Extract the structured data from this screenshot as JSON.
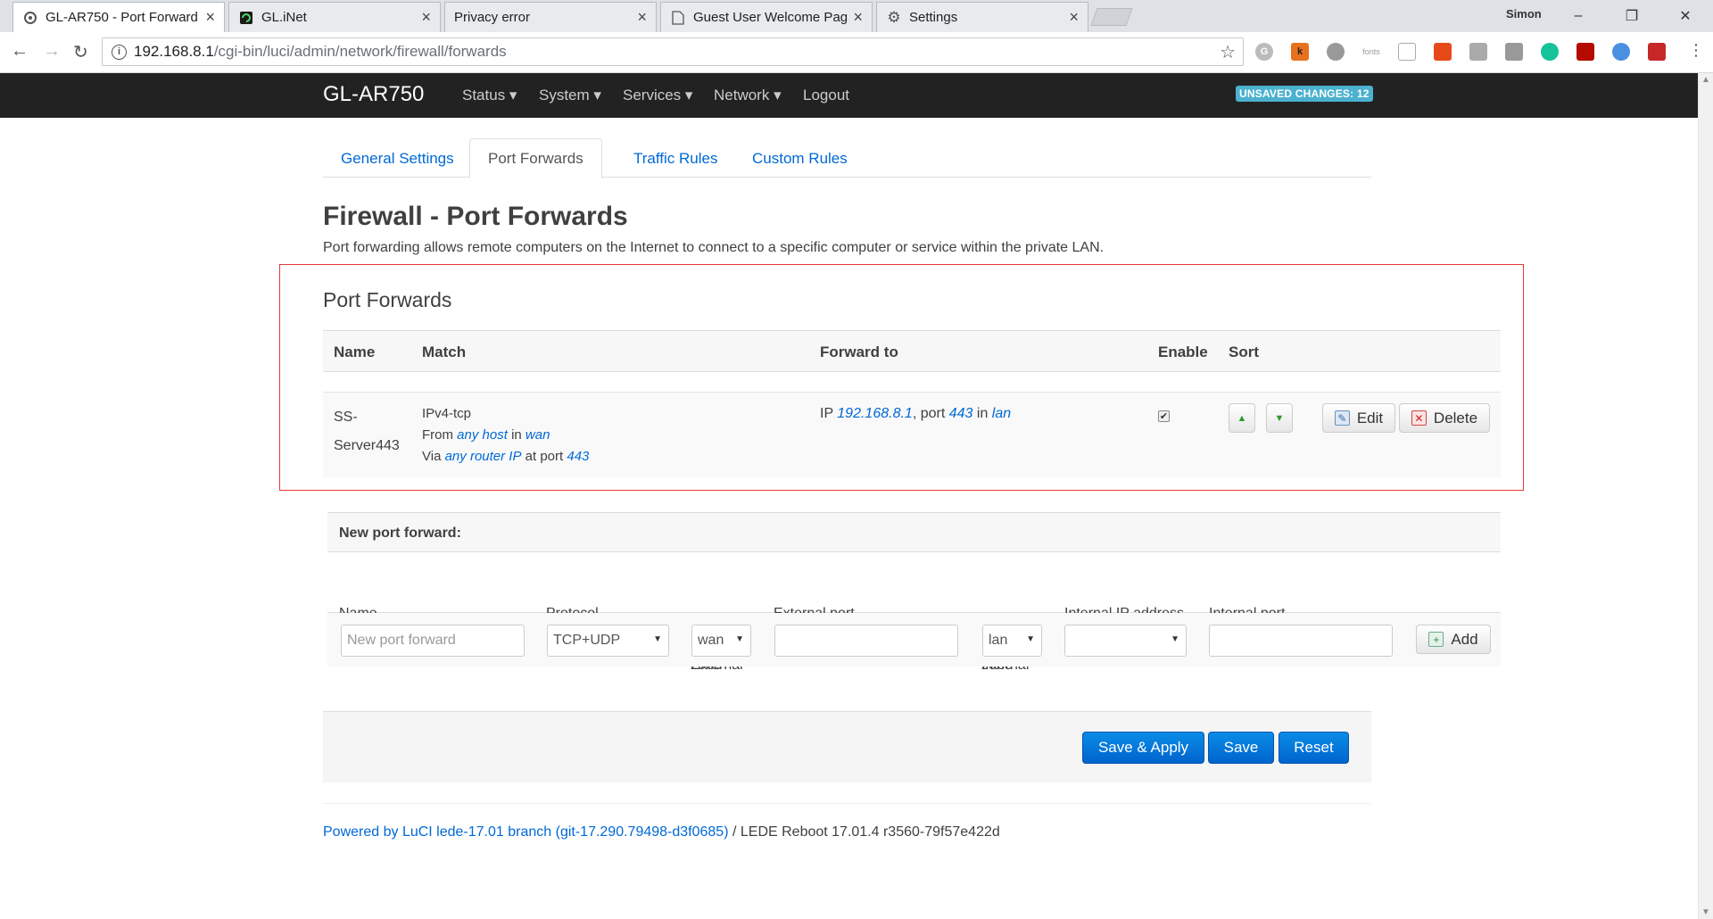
{
  "browser": {
    "tabs": [
      {
        "title": "GL-AR750 - Port Forward"
      },
      {
        "title": "GL.iNet"
      },
      {
        "title": "Privacy error"
      },
      {
        "title": "Guest User Welcome Pag"
      },
      {
        "title": "Settings"
      }
    ],
    "user": "Simon",
    "url_host": "192.168.8.1",
    "url_path": "/cgi-bin/luci/admin/network/firewall/forwards",
    "extensions": [
      "G",
      "k",
      "fonts"
    ]
  },
  "header": {
    "brand": "GL-AR750",
    "menu": [
      "Status",
      "System",
      "Services",
      "Network",
      "Logout"
    ],
    "unsaved": "UNSAVED CHANGES: 12"
  },
  "tabs": [
    "General Settings",
    "Port Forwards",
    "Traffic Rules",
    "Custom Rules"
  ],
  "page": {
    "title": "Firewall - Port Forwards",
    "description": "Port forwarding allows remote computers on the Internet to connect to a specific computer or service within the private LAN.",
    "section_title": "Port Forwards"
  },
  "table": {
    "headers": {
      "name": "Name",
      "match": "Match",
      "forward": "Forward to",
      "enable": "Enable",
      "sort": "Sort"
    },
    "row": {
      "name_line1": "SS-",
      "name_line2": "Server443",
      "proto": "IPv4-tcp",
      "from_prefix": "From",
      "from_host": "any host",
      "from_in": "in",
      "from_zone": "wan",
      "via_prefix": "Via",
      "via_host": "any router IP",
      "via_at": "at port",
      "via_port": "443",
      "fw_prefix": "IP",
      "fw_ip": "192.168.8.1",
      "fw_port_label": ", port",
      "fw_port": "443",
      "fw_in": "in",
      "fw_zone": "lan",
      "enabled": true
    },
    "edit": "Edit",
    "delete": "Delete"
  },
  "new_forward": {
    "title": "New port forward:",
    "columns": {
      "name": "Name",
      "protocol": "Protocol",
      "ext_zone_1": "External",
      "ext_zone_2": "zone",
      "ext_port": "External port",
      "int_zone_1": "Internal",
      "int_zone_2": "zone",
      "int_ip": "Internal IP address",
      "int_port": "Internal port"
    },
    "name_placeholder": "New port forward",
    "protocol_value": "TCP+UDP",
    "ext_zone_value": "wan",
    "int_zone_value": "lan",
    "add": "Add"
  },
  "actions": {
    "save_apply": "Save & Apply",
    "save": "Save",
    "reset": "Reset"
  },
  "footer": {
    "link": "Powered by LuCI lede-17.01 branch (git-17.290.79498-d3f0685)",
    "text": " / LEDE Reboot 17.01.4 r3560-79f57e422d"
  },
  "colors": {
    "accent": "#0069d6",
    "primary_button": "#0064cd",
    "highlight": "#e53935",
    "badge": "#4bb1cf"
  }
}
